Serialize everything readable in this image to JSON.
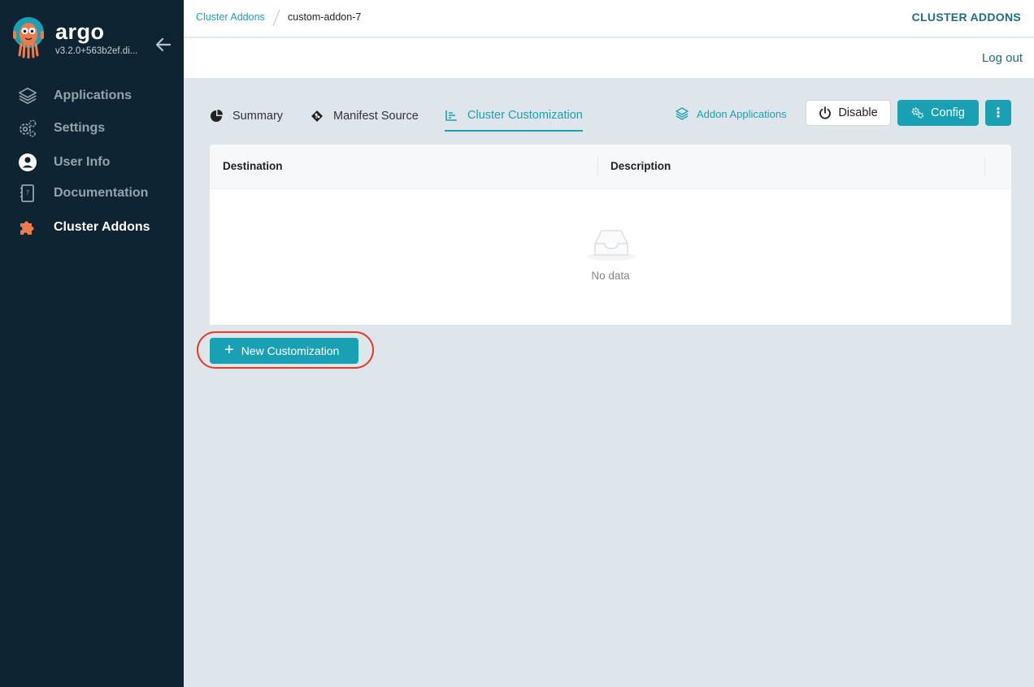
{
  "brand": {
    "name": "argo",
    "version": "v3.2.0+563b2ef.di..."
  },
  "nav": {
    "items": [
      {
        "label": "Applications",
        "icon": "layers-icon",
        "active": false
      },
      {
        "label": "Settings",
        "icon": "gears-icon",
        "active": false
      },
      {
        "label": "User Info",
        "icon": "user-circle-icon",
        "active": false
      },
      {
        "label": "Documentation",
        "icon": "book-icon",
        "active": false
      },
      {
        "label": "Cluster Addons",
        "icon": "puzzle-icon",
        "active": true
      }
    ]
  },
  "breadcrumb": {
    "parent": "Cluster Addons",
    "current": "custom-addon-7"
  },
  "header": {
    "title": "CLUSTER ADDONS",
    "logout": "Log out"
  },
  "tabs": [
    {
      "label": "Summary",
      "icon": "pie-chart-icon",
      "active": false
    },
    {
      "label": "Manifest Source",
      "icon": "git-diamond-icon",
      "active": false
    },
    {
      "label": "Cluster Customization",
      "icon": "list-chart-icon",
      "active": true
    }
  ],
  "toolbar": {
    "addon_applications": "Addon Applications",
    "disable": "Disable",
    "config": "Config",
    "more": "⋮"
  },
  "table": {
    "columns": [
      "Destination",
      "Description"
    ],
    "rows": [],
    "empty_text": "No data"
  },
  "actions": {
    "new_customization": "New Customization"
  },
  "colors": {
    "sidebar_bg": "#0e2432",
    "accent": "#1aa0b3",
    "title": "#1d6e84",
    "brand_orange": "#ef7b4d",
    "highlight": "#e53b24",
    "page_bg": "#dee6eb"
  }
}
